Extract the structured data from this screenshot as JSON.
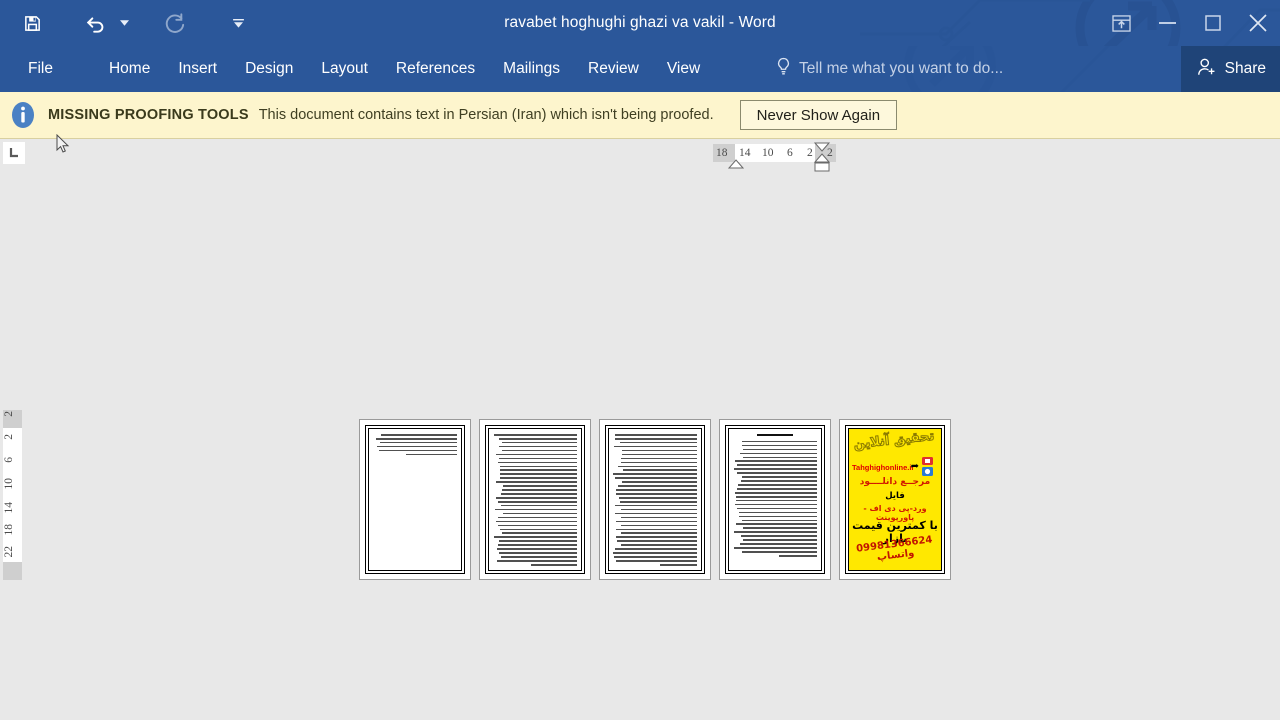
{
  "window": {
    "title": "ravabet hoghughi ghazi va vakil - Word",
    "quick_access": [
      {
        "name": "save",
        "icon": "save-icon",
        "label": "Save",
        "state": "enabled"
      },
      {
        "name": "undo",
        "icon": "undo-icon",
        "label": "Undo",
        "state": "enabled"
      },
      {
        "name": "redo",
        "icon": "redo-icon",
        "label": "Redo",
        "state": "disabled"
      },
      {
        "name": "customize",
        "icon": "customize-qat-icon",
        "label": "Customize Quick Access Toolbar"
      }
    ],
    "controls": [
      {
        "name": "ribbon-display-options",
        "icon": "ribbon-display-options-icon",
        "label": "Ribbon Display Options"
      },
      {
        "name": "minimize",
        "icon": "minimize-icon",
        "label": "Minimize"
      },
      {
        "name": "maximize",
        "icon": "maximize-icon",
        "label": "Restore Down"
      },
      {
        "name": "close",
        "icon": "close-icon",
        "label": "Close"
      }
    ]
  },
  "ribbon": {
    "tabs": [
      {
        "label": "File",
        "active": false
      },
      {
        "label": "Home",
        "active": false
      },
      {
        "label": "Insert",
        "active": false
      },
      {
        "label": "Design",
        "active": false
      },
      {
        "label": "Layout",
        "active": false
      },
      {
        "label": "References",
        "active": false
      },
      {
        "label": "Mailings",
        "active": false
      },
      {
        "label": "Review",
        "active": false
      },
      {
        "label": "View",
        "active": false
      }
    ],
    "tell_me": "Tell me what you want to do...",
    "share_label": "Share"
  },
  "notification": {
    "icon": "info-icon",
    "title": "MISSING PROOFING TOOLS",
    "message": "This document contains text in Persian (Iran) which isn't being proofed.",
    "button_label": "Never Show Again"
  },
  "rulers": {
    "tab_stop_icon": "left-tab-stop-icon",
    "horizontal_numbers": [
      "18",
      "14",
      "10",
      "6",
      "2",
      "2"
    ],
    "vertical_numbers": [
      "2",
      "2",
      "6",
      "10",
      "14",
      "18",
      "22"
    ],
    "indent_markers": [
      "first-line-indent",
      "hanging-indent",
      "left-indent",
      "right-indent"
    ]
  },
  "document": {
    "zoom_view": "multiple-pages",
    "pages": [
      {
        "n": 1,
        "type": "text",
        "lines": 6,
        "has_title": false,
        "fill": "partial"
      },
      {
        "n": 2,
        "type": "text",
        "lines": 34,
        "has_title": false,
        "fill": "full"
      },
      {
        "n": 3,
        "type": "text",
        "lines": 34,
        "has_title": false,
        "fill": "full"
      },
      {
        "n": 4,
        "type": "text",
        "lines": 30,
        "has_title": true,
        "fill": "full"
      },
      {
        "n": 5,
        "type": "advertisement",
        "lines": 0,
        "has_title": false,
        "fill": "ad"
      }
    ],
    "ad_page": {
      "background": "#ffe800",
      "heading": "تحقیق آنلاین",
      "url": "Tahghighonline.ir",
      "line2": "مرجــع دانلــــود",
      "line3": "فایل",
      "line4": "ورد-پی دی اف - پاورپوینت",
      "line5": "با کمترین قیمت بازار",
      "line6": "09981366624 واتساپ"
    }
  },
  "colors": {
    "title_bar": "#2b579a",
    "share_button": "#1f4478",
    "notification_bg": "#fdf5cd",
    "workspace_bg": "#e8e8e8",
    "ad_yellow": "#ffe800",
    "ad_red": "#d11a00"
  }
}
